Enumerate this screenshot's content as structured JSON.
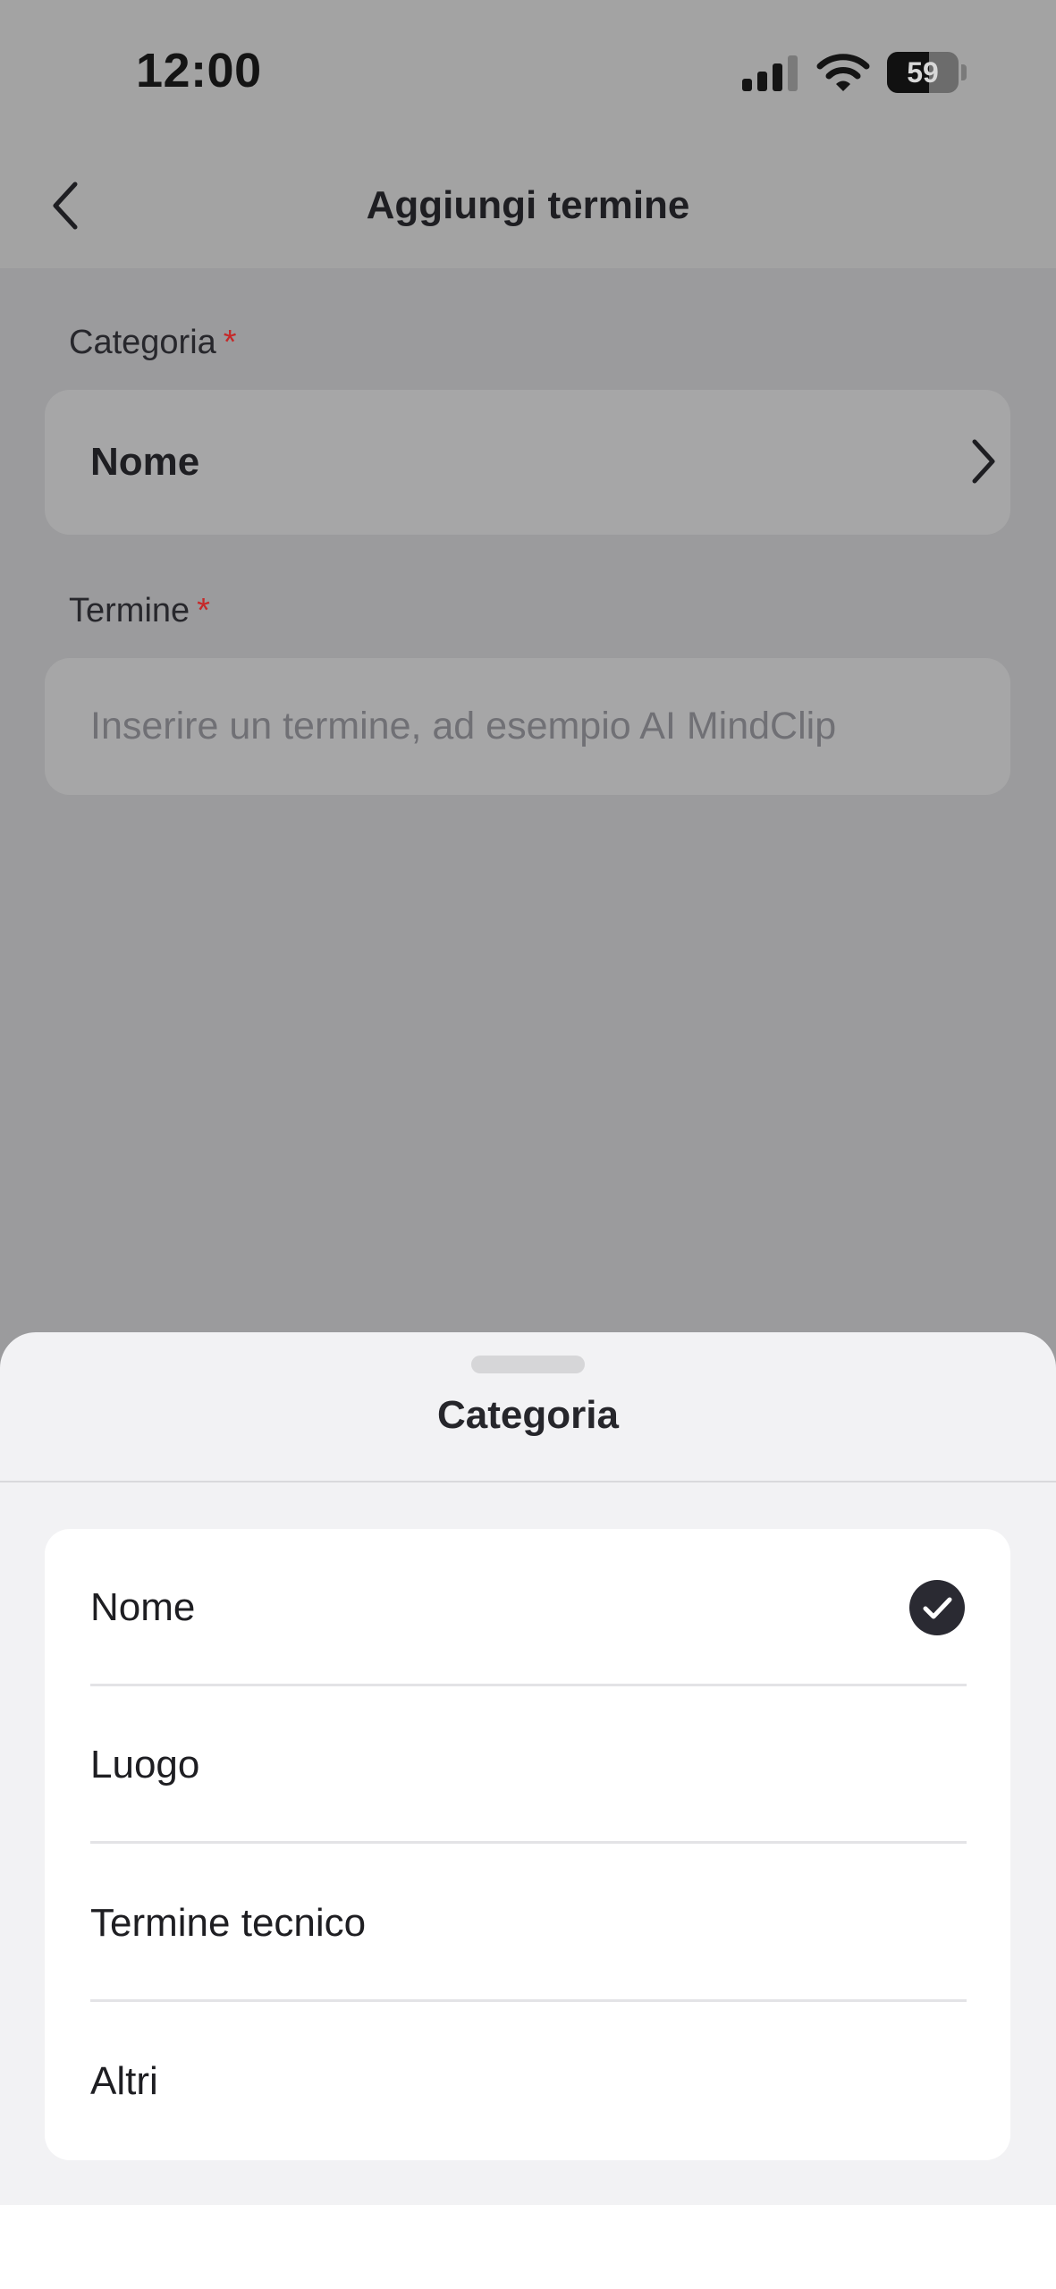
{
  "status_bar": {
    "time": "12:00",
    "battery_level": "59",
    "icons": [
      "signal-icon",
      "wifi-icon",
      "battery-icon"
    ]
  },
  "nav": {
    "title": "Aggiungi termine",
    "back_icon": "chevron-left-icon"
  },
  "form": {
    "category_label": "Categoria",
    "category_value": "Nome",
    "term_label": "Termine",
    "required_marker": "*",
    "term_value": "",
    "term_placeholder": "Inserire un termine, ad esempio AI MindClip"
  },
  "sheet": {
    "title": "Categoria",
    "options": [
      {
        "label": "Nome",
        "selected": true
      },
      {
        "label": "Luogo",
        "selected": false
      },
      {
        "label": "Termine tecnico",
        "selected": false
      },
      {
        "label": "Altri",
        "selected": false
      }
    ]
  },
  "colors": {
    "overlay_background": "#9b9b9d",
    "required": "#c62828",
    "check_fill": "#2a2a32",
    "sheet_background": "#f2f2f4"
  }
}
